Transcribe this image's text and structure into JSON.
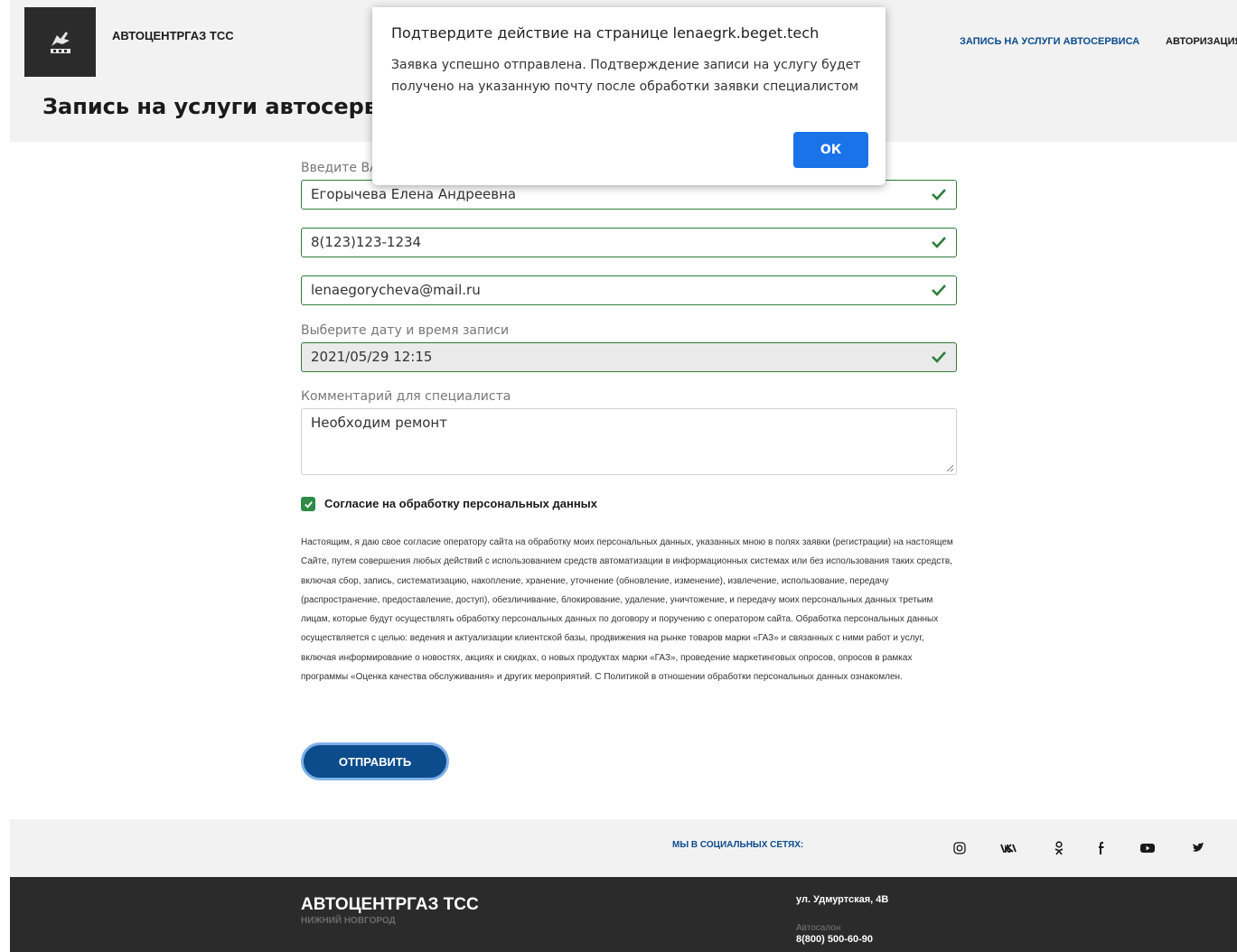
{
  "header": {
    "brand": "АВТОЦЕНТРГАЗ ТСС",
    "logo_icon": "gaz-deer-logo",
    "nav": {
      "book_service": "ЗАПИСЬ НА УСЛУГИ АВТОСЕРВИСА",
      "auth": "АВТОРИЗАЦИЯ"
    },
    "page_title": "Запись на услуги автосервиса"
  },
  "form": {
    "name_label": "Введите ВАШЕ ФИО",
    "name_value": "Егорычева Елена Андреевна",
    "phone_value": "8(123)123-1234",
    "email_value": "lenaegorycheva@mail.ru",
    "datetime_label": "Выберите дату и время записи",
    "datetime_value": "2021/05/29 12:15",
    "comment_label": "Комментарий для специалиста",
    "comment_value": "Необходим ремонт",
    "consent_label": "Согласие на обработку персональных данных",
    "consent_checked": true,
    "consent_text": "Настоящим, я даю свое согласие оператору сайта на обработку моих персональных данных, указанных мною в полях заявки (регистрации) на настоящем Сайте, путем совершения любых действий с использованием средств автоматизации в информационных системах или без использования таких средств, включая сбор, запись, систематизацию, накопление, хранение, уточнение (обновление, изменение), извлечение, использование, передачу (распространение, предоставление, доступ), обезличивание, блокирование, удаление, уничтожение, и передачу моих персональных данных третьим лицам, которые будут осуществлять обработку персональных данных по договору и поручению с оператором сайта. Обработка персональных данных осуществляется с целью: ведения и актуализации клиентской базы, продвижения на рынке товаров марки «ГАЗ» и связанных с ними работ и услуг, включая информирование о новостях, акциях и скидках, о новых продуктах марки «ГАЗ», проведение маркетинговых опросов, опросов в рамках программы «Оценка качества обслуживания» и других мероприятий. С Политикой в отношении обработки персональных данных ознакомлен.",
    "submit_label": "ОТПРАВИТЬ"
  },
  "footer": {
    "social_title": "МЫ В СОЦИАЛЬНЫХ СЕТЯХ:",
    "social_icons": [
      "instagram-icon",
      "vk-icon",
      "odnoklassniki-icon",
      "facebook-icon",
      "youtube-icon",
      "twitter-icon"
    ],
    "brand": "АВТОЦЕНТРГАЗ ТСС",
    "city": "НИЖНИЙ НОВГОРОД",
    "address": "ул. Удмуртская, 4В",
    "salon_label": "Автосалон",
    "phone": "8(800) 500-60-90"
  },
  "dialog": {
    "title": "Подтвердите действие на странице lenaegrk.beget.tech",
    "message": "Заявка успешно отправлена. Подтверждение записи на услугу будет получено на указанную почту после обработки заявки специалистом",
    "ok_label": "ОК"
  },
  "colors": {
    "accent_blue": "#0c4c8c",
    "valid_green": "#2e7d3a",
    "dialog_button": "#1a73e8",
    "footer_dark": "#2b2b2b"
  }
}
